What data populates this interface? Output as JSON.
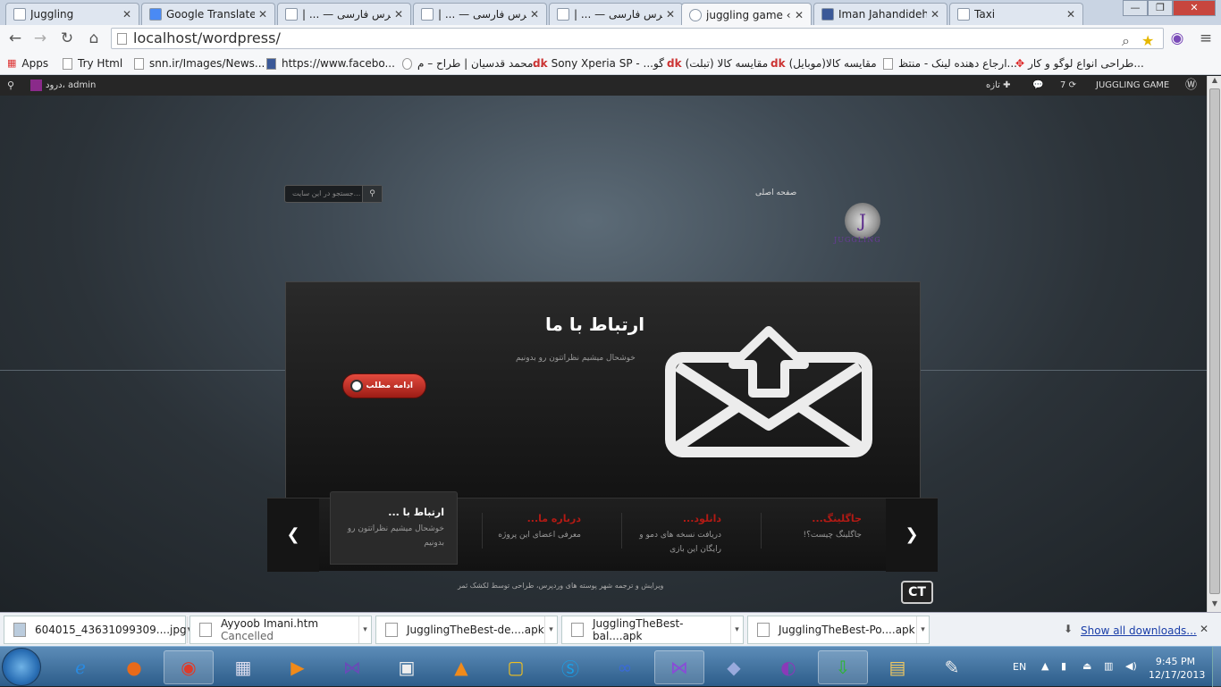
{
  "browser": {
    "tabs": [
      {
        "label": "Juggling",
        "active": false
      },
      {
        "label": "Google Translate",
        "active": false
      },
      {
        "label": "| ... — وردپرس فارسی",
        "active": false
      },
      {
        "label": "| ... — وردپرس فارسی",
        "active": false
      },
      {
        "label": "| ... — وردپرس فارسی",
        "active": false
      },
      {
        "label": "juggling game ‹ بنگ",
        "active": true
      },
      {
        "label": "Iman Jahandideh",
        "active": false
      },
      {
        "label": "Taxi",
        "active": false
      }
    ],
    "url": "localhost/wordpress/",
    "bookmarks": [
      "Apps",
      "Try Html",
      "snn.ir/Images/News...",
      "https://www.facebo...",
      "محمد قدسیان | طراح – م...",
      "Sony Xperia SP - ...گو",
      "مقایسه کالا (تبلت)",
      "مقایسه کالا(موبایل)",
      "ارجاع دهنده لینک - منتظ...",
      "طراحی انواع لوگو و کار..."
    ]
  },
  "admin_bar": {
    "user_greeting": "درود، admin",
    "site_name": "JUGGLING GAME",
    "updates_count": "7",
    "new_label": "تازه"
  },
  "site": {
    "search_placeholder": "جستجو در این سایت...",
    "home_link": "صفحه اصلی",
    "logo_letter": "J",
    "logo_text": "JUGGLING",
    "hero": {
      "title": "ارتباط با ما",
      "description": "خوشحال میشیم نظراتتون رو بدونیم",
      "button_label": "ادامه مطلب"
    },
    "slides": [
      {
        "title": "ارتباط با ...",
        "desc": "خوشحال میشیم نظراتتون رو بدونیم"
      },
      {
        "title": "درباره ما...",
        "desc": "معرفی اعضای این پروژه"
      },
      {
        "title": "دانلود...",
        "desc": "دریافت نسخه های دمو و رایگان این بازی"
      },
      {
        "title": "جاگلینگ...",
        "desc": "جاگلینگ چیست؟!"
      }
    ],
    "footer_text": "ویرایش و ترجمه شهر پوسته های وردپرس، طراحی توسط لکشک ثمر",
    "ct_logo": "CT"
  },
  "downloads": {
    "items": [
      {
        "name": "604015_43631099309....jpg",
        "status": ""
      },
      {
        "name": "Ayyoob Imani.htm",
        "status": "Cancelled"
      },
      {
        "name": "JugglingTheBest-de....apk",
        "status": ""
      },
      {
        "name": "JugglingTheBest-bal....apk",
        "status": ""
      },
      {
        "name": "JugglingTheBest-Po....apk",
        "status": ""
      }
    ],
    "show_all": "Show all downloads..."
  },
  "taskbar": {
    "language": "EN",
    "time": "9:45 PM",
    "date": "12/17/2013"
  }
}
